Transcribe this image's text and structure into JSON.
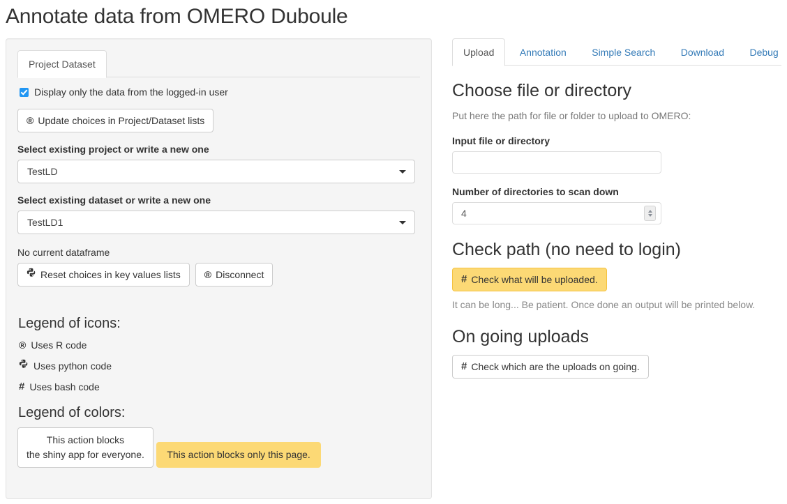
{
  "page": {
    "title": "Annotate data from OMERO Duboule"
  },
  "left_panel": {
    "tabs": [
      {
        "label": "Project Dataset",
        "active": true
      }
    ],
    "checkbox": {
      "label": "Display only the data from the logged-in user",
      "checked": true,
      "accent_color": "#2196f3"
    },
    "update_button": {
      "icon": "r-code-icon",
      "icon_glyph": "®",
      "label": "Update choices in Project/Dataset lists"
    },
    "project_field": {
      "label": "Select existing project or write a new one",
      "value": "TestLD"
    },
    "dataset_field": {
      "label": "Select existing dataset or write a new one",
      "value": "TestLD1"
    },
    "dataframe_status": "No current dataframe",
    "reset_button": {
      "icon": "python-code-icon",
      "icon_glyph": "🐍",
      "label": "Reset choices in key values lists"
    },
    "disconnect_button": {
      "icon": "r-code-icon",
      "icon_glyph": "®",
      "label": "Disconnect"
    },
    "legend_icons": {
      "heading": "Legend of icons:",
      "items": [
        {
          "icon": "r-code-icon",
          "icon_glyph": "®",
          "label": "Uses R code"
        },
        {
          "icon": "python-code-icon",
          "icon_glyph": "🐍",
          "label": "Uses python code"
        },
        {
          "icon": "bash-code-icon",
          "icon_glyph": "#",
          "label": "Uses bash code"
        }
      ]
    },
    "legend_colors": {
      "heading": "Legend of colors:",
      "white_swatch": "This action blocks\nthe shiny app for everyone.",
      "warn_swatch": "This action blocks only this page.",
      "warn_color": "#fcd975",
      "white_color": "#ffffff"
    }
  },
  "right_panel": {
    "tabs": [
      {
        "label": "Upload",
        "active": true
      },
      {
        "label": "Annotation",
        "active": false
      },
      {
        "label": "Simple Search",
        "active": false
      },
      {
        "label": "Download",
        "active": false
      },
      {
        "label": "Debug",
        "active": false
      }
    ],
    "choose_section": {
      "heading": "Choose file or directory",
      "description": "Put here the path for file or folder to upload to OMERO:",
      "input_label": "Input file or directory",
      "input_value": "",
      "input_placeholder": "",
      "depth_label": "Number of directories to scan down",
      "depth_value": "4"
    },
    "check_section": {
      "heading": "Check path (no need to login)",
      "button": {
        "icon": "bash-code-icon",
        "icon_glyph": "#",
        "label": "Check what will be uploaded."
      },
      "note": "It can be long... Be patient. Once done an output will be printed below."
    },
    "ongoing_section": {
      "heading": "On going uploads",
      "button": {
        "icon": "bash-code-icon",
        "icon_glyph": "#",
        "label": "Check which are the uploads on going."
      }
    }
  }
}
